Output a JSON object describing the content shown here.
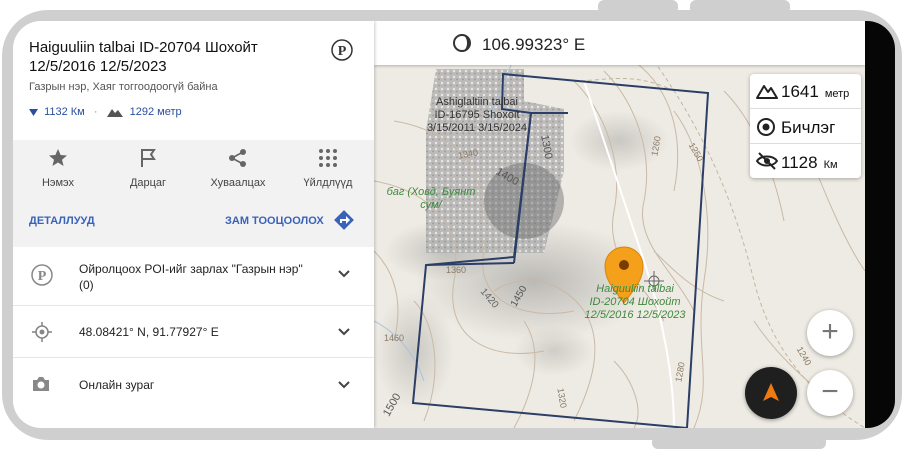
{
  "place": {
    "title": "Haiguuliin talbai ID-20704 Шохойт 12/5/2016 12/5/2023",
    "subtitle": "Газрын нэр, Хаяг тоггоодоогүй байна",
    "distance": "1132 Км",
    "elevation": "1292 метр"
  },
  "actions": [
    {
      "label": "Нэмэх",
      "icon": "star-icon"
    },
    {
      "label": "Дарцаг",
      "icon": "flag-icon"
    },
    {
      "label": "Хуваалцах",
      "icon": "share-icon"
    },
    {
      "label": "Үйлдлүүд",
      "icon": "grid-icon"
    }
  ],
  "links": {
    "details": "ДЕТАЛЛУУД",
    "route": "ЗАМ ТООЦООЛОХ"
  },
  "list": [
    {
      "text": "Ойролцоох POI-ийг зарлах \"Газрын нэр\" (0)",
      "icon": "poi-icon"
    },
    {
      "text": "48.08421° N, 91.77927° E",
      "icon": "location-icon"
    },
    {
      "text": "Онлайн зураг",
      "icon": "camera-icon"
    }
  ],
  "map": {
    "top_coordinate": "106.99323° E",
    "info": {
      "altitude": "1641",
      "altitude_unit": "метр",
      "mode": "Бичлэг",
      "visibility": "1128",
      "visibility_unit": "Км"
    },
    "labels": {
      "area1_name": "Ashiglaltiin talbai",
      "area1_id": "ID-16795 Shoxoit",
      "area1_dates": "3/15/2011 3/15/2024",
      "area2_name": "Haiguuliin talbai",
      "area2_id": "ID-20704 Шохойт",
      "area2_dates": "12/5/2016 12/5/2023",
      "region_1": "баг (Ховд, Буянт",
      "region_2": "сум/"
    },
    "contour_labels": [
      "1340",
      "1400",
      "1300",
      "1260",
      "1250",
      "1360",
      "1420",
      "1450",
      "1460",
      "1280",
      "1240",
      "1320",
      "1500"
    ],
    "zoom_in": "+",
    "zoom_out": "−"
  }
}
